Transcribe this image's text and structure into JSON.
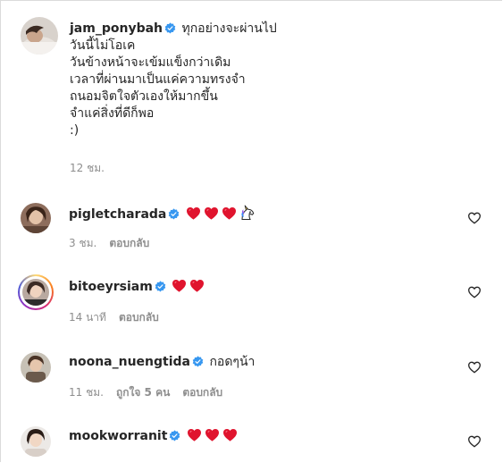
{
  "colors": {
    "text": "#262626",
    "muted": "#8e8e8e",
    "verified": "#3797f0",
    "heart": "#e0142e"
  },
  "caption": {
    "username": "jam_ponybah",
    "lines": [
      "ทุกอย่างจะผ่านไป",
      "วันนี้ไม่โอเค",
      "วันข้างหน้าจะเข้มแข็งกว่าเดิม",
      "เวลาที่ผ่านมาเป็นแค่ความทรงจำ",
      "ถนอมจิตใจตัวเองให้มากขึ้น",
      "จำแค่สิ่งที่ดีก็พอ",
      ":)"
    ],
    "time": "12 ชม."
  },
  "comments": [
    {
      "username": "pigletcharada",
      "text": "",
      "emojis": [
        "red-heart",
        "red-heart",
        "red-heart",
        "unicorn"
      ],
      "time": "3 ชม.",
      "likes": "",
      "reply": "ตอบกลับ",
      "story_ring": false
    },
    {
      "username": "bitoeyrsiam",
      "text": "",
      "emojis": [
        "red-heart",
        "red-heart"
      ],
      "time": "14 นาที",
      "likes": "",
      "reply": "ตอบกลับ",
      "story_ring": true
    },
    {
      "username": "noona_nuengtida",
      "text": "กอดๆน้า",
      "emojis": [],
      "time": "11 ชม.",
      "likes": "ถูกใจ 5 คน",
      "reply": "ตอบกลับ",
      "story_ring": false
    },
    {
      "username": "mookworranit",
      "text": "",
      "emojis": [
        "red-heart",
        "red-heart",
        "red-heart"
      ],
      "time": "",
      "likes": "",
      "reply": "",
      "story_ring": false
    }
  ]
}
